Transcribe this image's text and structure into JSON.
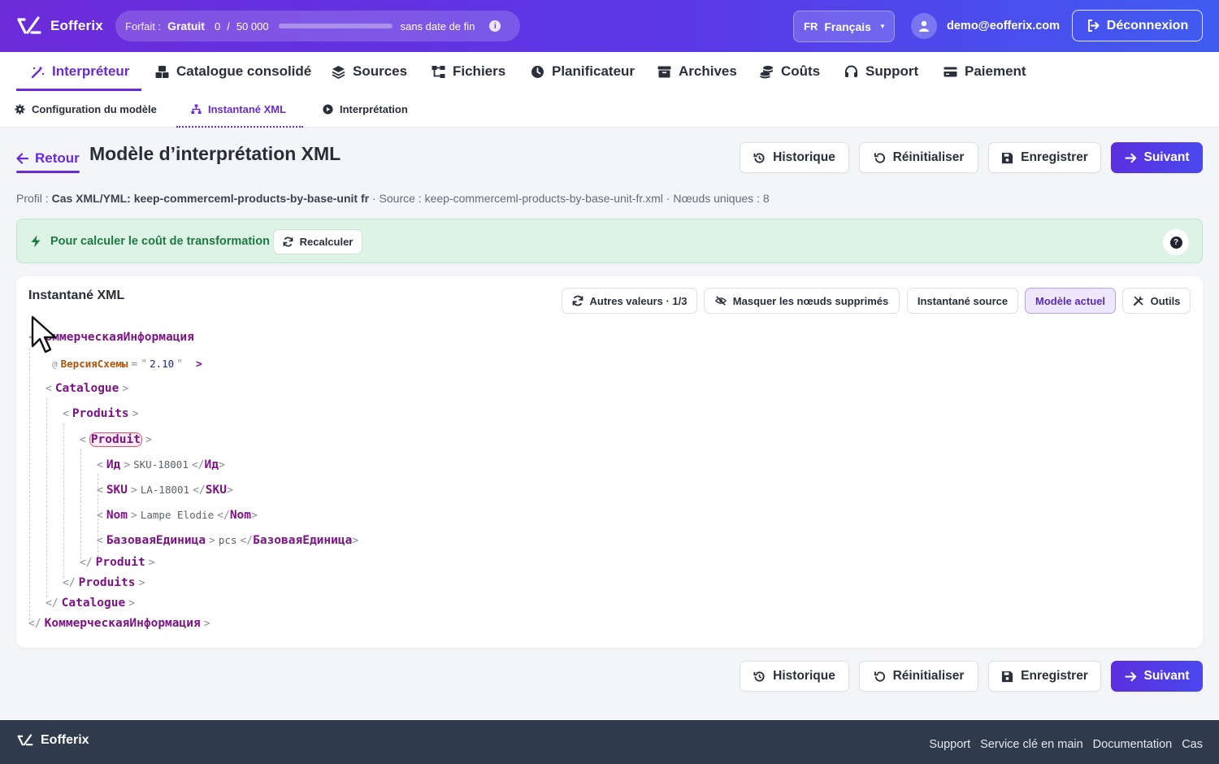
{
  "app": {
    "name": "Eofferix"
  },
  "plan": {
    "label": "Forfait :",
    "name": "Gratuit",
    "used": "0",
    "separator": "/",
    "limit": "50 000",
    "usage_fraction": 0,
    "validity": "sans date de fin"
  },
  "language": {
    "code": "FR",
    "name": "Français"
  },
  "user": {
    "email": "demo@eofferix.com"
  },
  "logout_label": "Déconnexion",
  "main_nav": [
    {
      "label": "Interpréteur",
      "icon": "magic-wand-icon",
      "active": true
    },
    {
      "label": "Catalogue consolidé",
      "icon": "boxes-icon"
    },
    {
      "label": "Sources",
      "icon": "layers-icon"
    },
    {
      "label": "Fichiers",
      "icon": "sitemap-icon"
    },
    {
      "label": "Planificateur",
      "icon": "clock-icon"
    },
    {
      "label": "Archives",
      "icon": "archive-icon"
    },
    {
      "label": "Coûts",
      "icon": "coins-icon"
    },
    {
      "label": "Support",
      "icon": "headset-icon"
    },
    {
      "label": "Paiement",
      "icon": "credit-card-icon"
    }
  ],
  "sub_nav": [
    {
      "label": "Configuration du modèle",
      "icon": "gear-icon"
    },
    {
      "label": "Instantané XML",
      "icon": "hierarchy-icon",
      "active": true
    },
    {
      "label": "Interprétation",
      "icon": "play-circle-icon"
    }
  ],
  "page": {
    "back_label": "Retour",
    "title": "Modèle d’interprétation XML",
    "actions": {
      "history": "Historique",
      "reset": "Réinitialiser",
      "save": "Enregistrer",
      "next": "Suivant"
    },
    "profile": {
      "profile_label": "Profil :",
      "profile_value": "Cas XML/YML: keep-commerceml-products-by-base-unit fr",
      "source_label": "· Source :",
      "source_value": "keep-commerceml-products-by-base-unit-fr.xml",
      "nodes_label": "· Nœuds uniques :",
      "nodes_value": "8"
    }
  },
  "alert": {
    "text": "Pour calculer le coût de transformation",
    "button": "Recalculer",
    "color": "#1d7a44"
  },
  "snapshot": {
    "title": "Instantané XML",
    "tools": {
      "other_values": "Autres valeurs · 1/3",
      "hide_deleted": "Masquer les nœuds supprimés",
      "source_snapshot": "Instantané source",
      "current_model": "Modèle actuel",
      "tools": "Outils"
    },
    "xml": {
      "root": "КоммерческаяИнформация",
      "root_attr_name": "ВерсияСхемы",
      "root_attr_value": "2.10",
      "catalogue": "Catalogue",
      "products": "Produits",
      "product": "Produit",
      "fields": [
        {
          "tag": "Ид",
          "value": "SKU-18001"
        },
        {
          "tag": "SKU",
          "value": "LA-18001"
        },
        {
          "tag": "Nom",
          "value": "Lampe Elodie"
        },
        {
          "tag": "БазоваяЕдиница",
          "value": "pcs"
        }
      ]
    }
  },
  "footer": {
    "links": [
      "Support",
      "Service clé en main",
      "Documentation",
      "Cas"
    ]
  },
  "colors": {
    "accent": "#6a2bd6",
    "tag": "#7c1486",
    "attribute": "#b0550b",
    "attribute_value": "#1e2b85"
  }
}
